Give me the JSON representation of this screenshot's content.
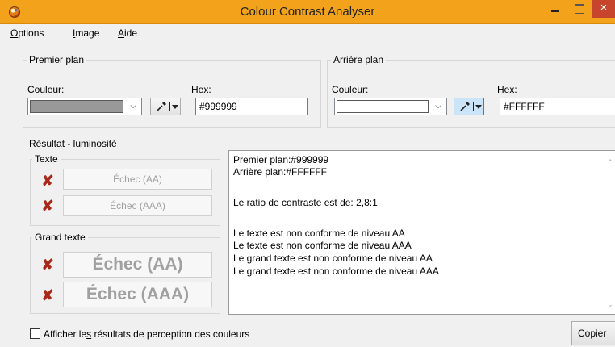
{
  "window": {
    "title": "Colour Contrast Analyser",
    "close_glyph": "×"
  },
  "menu": {
    "items": [
      {
        "accel": "O",
        "rest": "ptions"
      },
      {
        "accel": "I",
        "rest": "mage"
      },
      {
        "accel": "A",
        "rest": "ide"
      }
    ]
  },
  "foreground": {
    "title": "Premier plan",
    "color_label_pre": "Co",
    "color_label_accel": "u",
    "color_label_post": "leur:",
    "hex_label": "Hex:",
    "hex_value": "#999999",
    "swatch_color": "#999999"
  },
  "background": {
    "title": "Arrière plan",
    "color_label_pre": "Co",
    "color_label_accel": "u",
    "color_label_post": "leur:",
    "hex_label": "Hex:",
    "hex_value": "#FFFFFF",
    "swatch_color": "#FFFFFF"
  },
  "result": {
    "title": "Résultat - luminosité",
    "text_group": {
      "title": "Texte",
      "aa": "Échec (AA)",
      "aaa": "Échec (AAA)"
    },
    "large_group": {
      "title": "Grand texte",
      "aa": "Échec (AA)",
      "aaa": "Échec (AAA)"
    },
    "fail_mark": "✘",
    "report_lines": [
      "Premier plan:#999999",
      "Arrière plan:#FFFFFF",
      "Le ratio de contraste est de: 2,8:1",
      "Le texte est non conforme de niveau AA",
      "Le texte est non conforme de niveau AAA",
      "Le grand texte est non conforme de niveau AA",
      "Le grand texte est non conforme de niveau AAA"
    ]
  },
  "footer": {
    "checkbox_pre": "Afficher le",
    "checkbox_accel": "s",
    "checkbox_post": " résultats de perception des couleurs",
    "copy_label": "Copier"
  },
  "colors": {
    "titlebar": "#f2a31b",
    "close": "#c7452d",
    "fail": "#a8291a",
    "picker_active": "#cce4f7"
  },
  "icons": {
    "app": "palette-icon",
    "dropper": "eyedropper-icon",
    "fail": "cross-icon",
    "dropdown": "chevron-down-icon"
  }
}
